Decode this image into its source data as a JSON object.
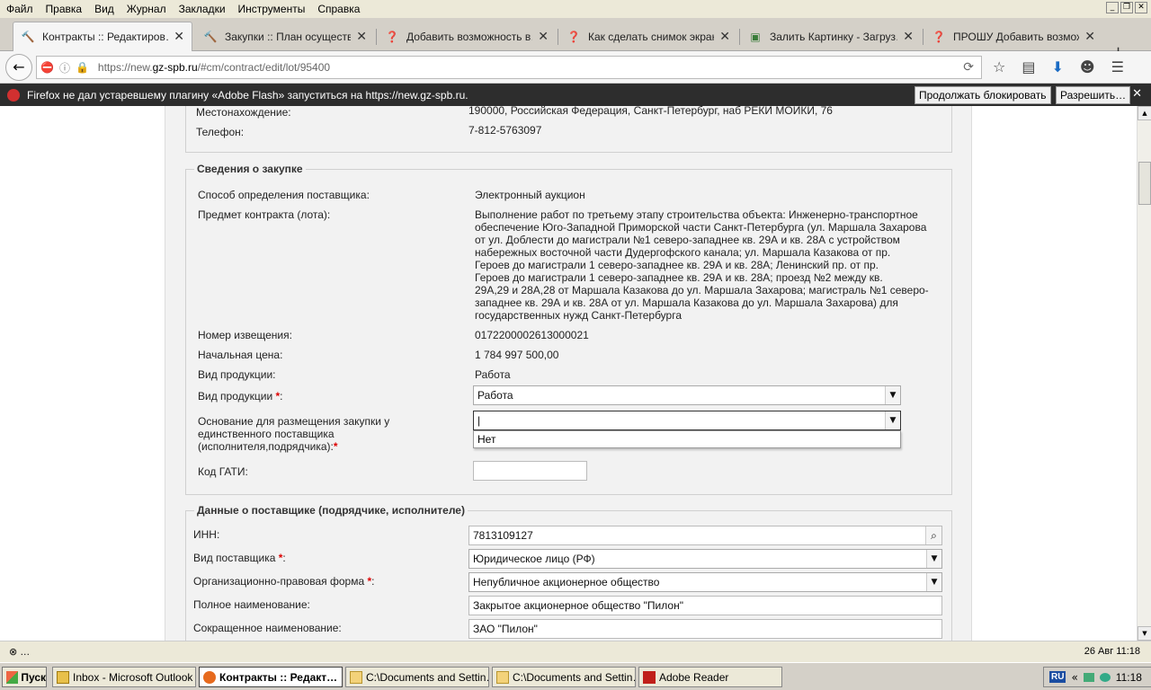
{
  "menu": [
    "Файл",
    "Правка",
    "Вид",
    "Журнал",
    "Закладки",
    "Инструменты",
    "Справка"
  ],
  "tabs": [
    {
      "title": "Контракты :: Редактиров…",
      "icon": "hammer-icon",
      "active": true
    },
    {
      "title": "Закупки :: План осуществ…",
      "icon": "hammer-icon",
      "active": false
    },
    {
      "title": "Добавить возможность в…",
      "icon": "help-globe-icon",
      "active": false
    },
    {
      "title": "Как сделать снимок экран…",
      "icon": "help-globe-icon",
      "active": false
    },
    {
      "title": "Залить Картинку - Загруз…",
      "icon": "image-icon",
      "active": false
    },
    {
      "title": "ПРОШУ Добавить возмож…",
      "icon": "help-globe-icon",
      "active": false
    }
  ],
  "url": {
    "prefix": "https://new.",
    "domain": "gz-spb.ru",
    "suffix": "/#cm/contract/edit/lot/95400"
  },
  "notification": {
    "text": "Firefox не дал устаревшему плагину «Adobe Flash» запуститься на https://new.gz-spb.ru.",
    "continue_btn": "Продолжать блокировать",
    "allow_btn": "Разрешить…"
  },
  "top_rows": [
    {
      "label": "Местонахождение:",
      "value": "190000, Российская Федерация, Санкт-Петербург, наб РЕКИ МОЙКИ, 76"
    },
    {
      "label": "Телефон:",
      "value": "7-812-5763097"
    }
  ],
  "procurement": {
    "legend": "Сведения о закупке",
    "method_label": "Способ определения поставщика:",
    "method_value": "Электронный аукцион",
    "subject_label": "Предмет контракта (лота):",
    "subject_lines": [
      "Выполнение работ по третьему этапу строительства объекта: Инженерно-транспортное",
      "обеспечение Юго-Западной Приморской части Санкт-Петербурга (ул. Маршала Захарова",
      "от ул. Доблести до магистрали №1 северо-западнее кв. 29А и кв. 28А с устройством",
      "набережных восточной части Дудергофского канала; ул. Маршала Казакова от пр.",
      "Героев до магистрали 1 северо-западнее кв. 29А и кв. 28А; Ленинский пр. от пр.",
      "Героев до магистрали 1 северо-западнее кв. 29А и кв. 28А; проезд №2 между кв.",
      "29А,29 и 28А,28 от Маршала Казакова до ул. Маршала Захарова; магистраль №1 северо-",
      "западнее кв. 29А и кв. 28А от ул. Маршала Казакова до ул. Маршала Захарова) для",
      "государственных нужд Санкт-Петербурга"
    ],
    "notice_label": "Номер извещения:",
    "notice_value": "0172200002613000021",
    "price_label": "Начальная цена:",
    "price_value": "1 784 997 500,00",
    "product_type_label": "Вид продукции:",
    "product_type_value": "Работа",
    "product_type2_label": "Вид продукции",
    "product_type2_value": "Работа",
    "basis_label_lines": [
      "Основание для размещения закупки у",
      "единственного поставщика",
      "(исполнителя,подрядчика):"
    ],
    "basis_value": "|",
    "basis_option": "Нет",
    "gati_label": "Код ГАТИ:",
    "gati_value": ""
  },
  "supplier": {
    "legend": "Данные о поставщике (подрядчике, исполнителе)",
    "inn_label": "ИНН:",
    "inn_value": "7813109127",
    "type_label": "Вид поставщика",
    "type_value": "Юридическое лицо (РФ)",
    "org_form_label": "Организационно-правовая форма",
    "org_form_value": "Непубличное акционерное общество",
    "full_name_label": "Полное наименование:",
    "full_name_value": "Закрытое акционерное общество \"Пилон\"",
    "short_name_label": "Сокращенное наименование:",
    "short_name_value": "ЗАО \"Пилон\""
  },
  "status": {
    "left": "⊗ …",
    "right": "26 Авг 11:18"
  },
  "taskbar": {
    "start": "Пуск",
    "tasks": [
      {
        "label": "Inbox - Microsoft Outlook",
        "active": false
      },
      {
        "label": "Контракты :: Редакт…",
        "active": true
      },
      {
        "label": "C:\\Documents and Settin…",
        "active": false
      },
      {
        "label": "C:\\Documents and Settin…",
        "active": false
      },
      {
        "label": "Adobe Reader",
        "active": false
      }
    ],
    "lang": "RU",
    "clock": "11:18"
  },
  "colors": {
    "required": "#dd0000",
    "notif_bg": "#2d2d2d",
    "panel_bg": "#f2f2f2"
  }
}
